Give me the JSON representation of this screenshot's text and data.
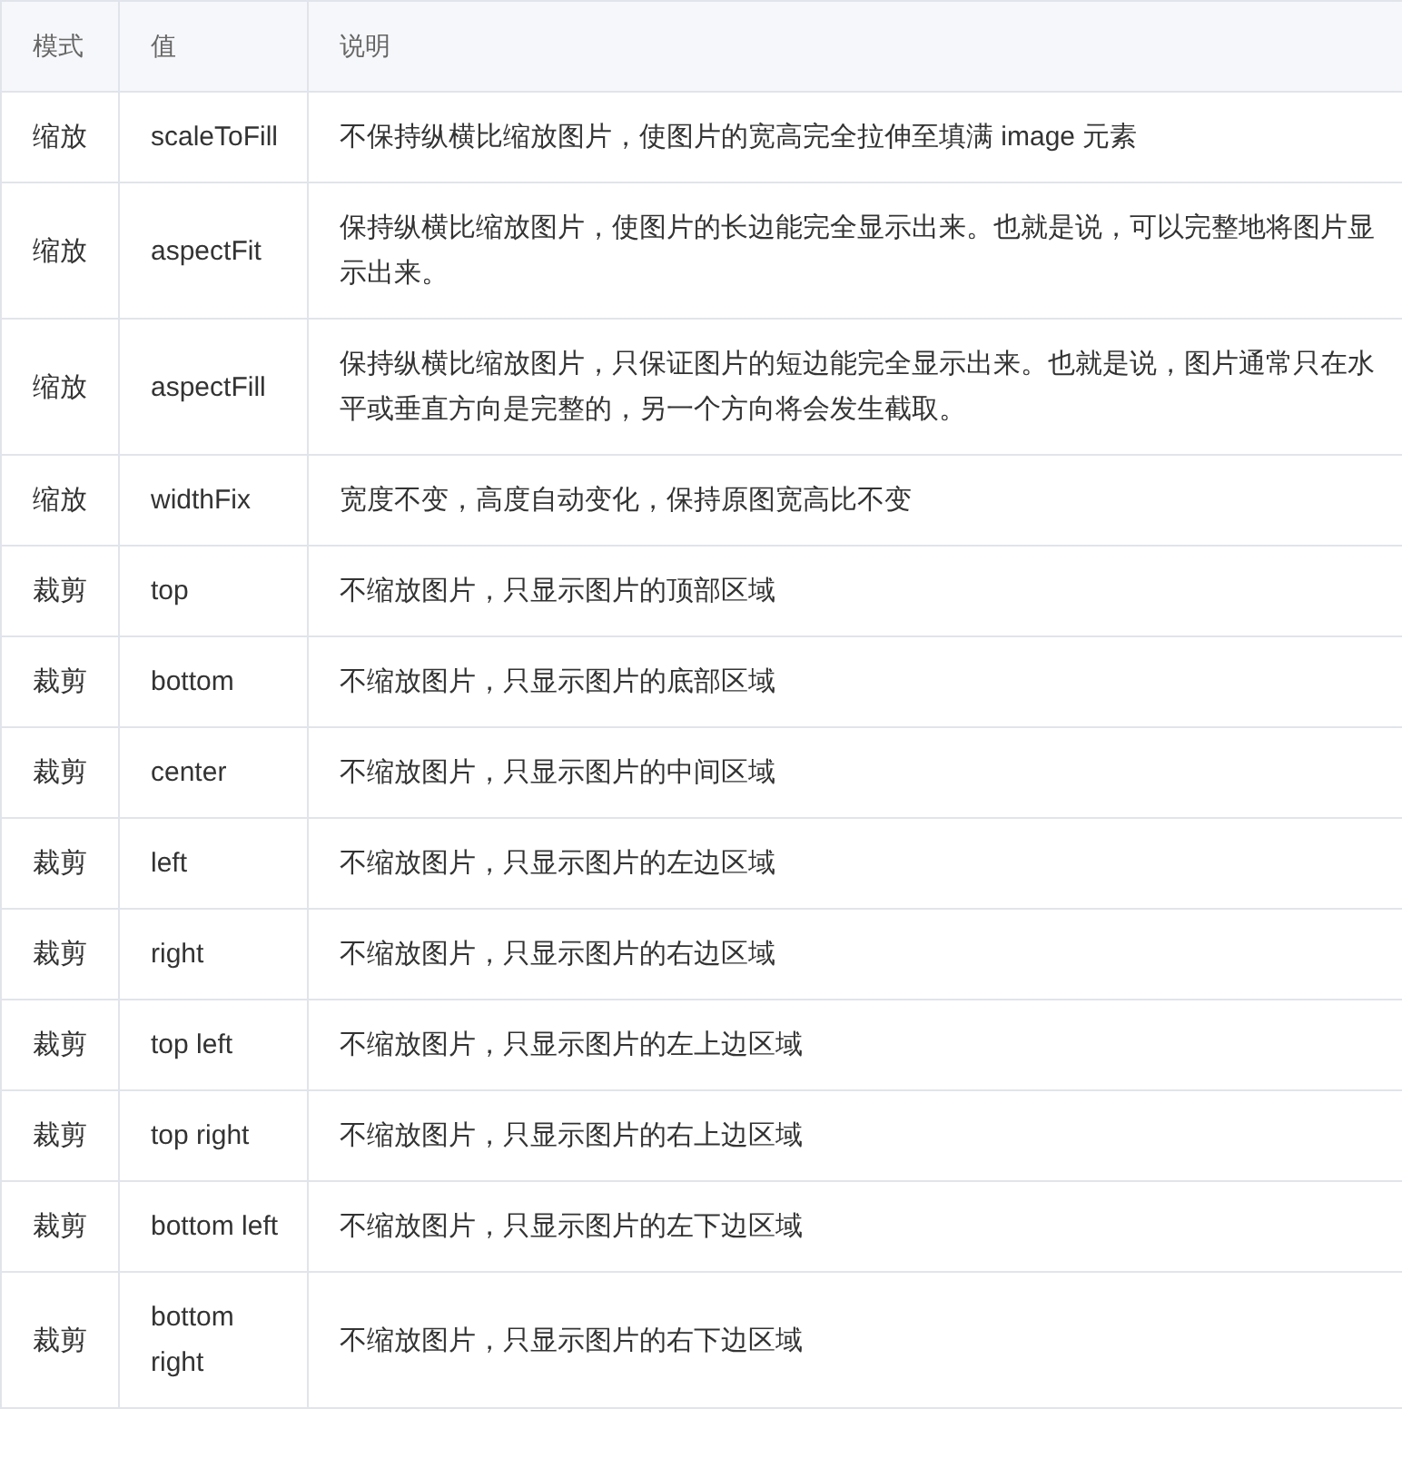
{
  "table": {
    "columns": [
      "模式",
      "值",
      "说明"
    ],
    "rows": [
      [
        "缩放",
        "scaleToFill",
        "不保持纵横比缩放图片，使图片的宽高完全拉伸至填满 image 元素"
      ],
      [
        "缩放",
        "aspectFit",
        "保持纵横比缩放图片，使图片的长边能完全显示出来。也就是说，可以完整地将图片显示出来。"
      ],
      [
        "缩放",
        "aspectFill",
        "保持纵横比缩放图片，只保证图片的短边能完全显示出来。也就是说，图片通常只在水平或垂直方向是完整的，另一个方向将会发生截取。"
      ],
      [
        "缩放",
        "widthFix",
        "宽度不变，高度自动变化，保持原图宽高比不变"
      ],
      [
        "裁剪",
        "top",
        "不缩放图片，只显示图片的顶部区域"
      ],
      [
        "裁剪",
        "bottom",
        "不缩放图片，只显示图片的底部区域"
      ],
      [
        "裁剪",
        "center",
        "不缩放图片，只显示图片的中间区域"
      ],
      [
        "裁剪",
        "left",
        "不缩放图片，只显示图片的左边区域"
      ],
      [
        "裁剪",
        "right",
        "不缩放图片，只显示图片的右边区域"
      ],
      [
        "裁剪",
        "top left",
        "不缩放图片，只显示图片的左上边区域"
      ],
      [
        "裁剪",
        "top right",
        "不缩放图片，只显示图片的右上边区域"
      ],
      [
        "裁剪",
        "bottom left",
        "不缩放图片，只显示图片的左下边区域"
      ],
      [
        "裁剪",
        "bottom right",
        "不缩放图片，只显示图片的右下边区域"
      ]
    ]
  }
}
